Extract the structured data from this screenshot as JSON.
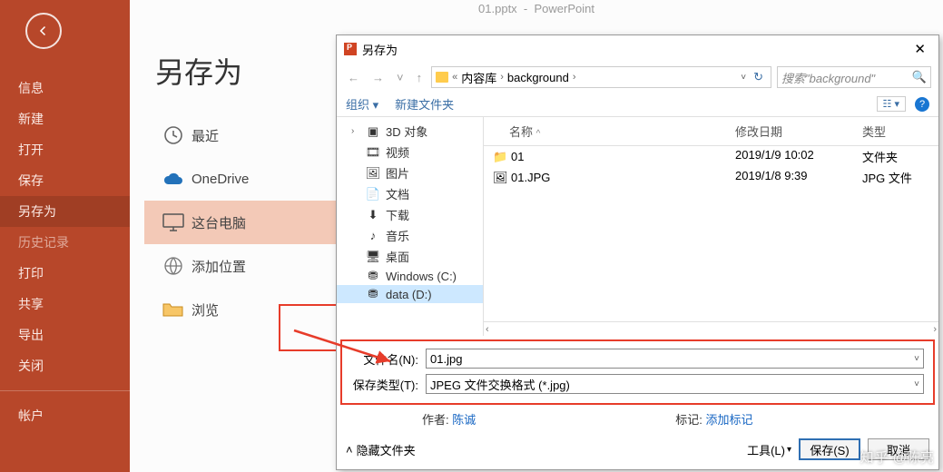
{
  "titlebar": {
    "doc": "01.pptx",
    "app": "PowerPoint"
  },
  "page_title": "另存为",
  "sidebar": {
    "items": [
      {
        "label": "信息"
      },
      {
        "label": "新建"
      },
      {
        "label": "打开"
      },
      {
        "label": "保存"
      },
      {
        "label": "另存为"
      },
      {
        "label": "历史记录"
      },
      {
        "label": "打印"
      },
      {
        "label": "共享"
      },
      {
        "label": "导出"
      },
      {
        "label": "关闭"
      },
      {
        "label": "帐户"
      }
    ]
  },
  "locations": {
    "recent": "最近",
    "onedrive": "OneDrive",
    "thispc": "这台电脑",
    "addplace": "添加位置",
    "browse": "浏览"
  },
  "dialog": {
    "title": "另存为",
    "breadcrumb": {
      "lib": "内容库",
      "folder": "background"
    },
    "search_placeholder": "搜索\"background\"",
    "toolbar": {
      "organize": "组织",
      "newfolder": "新建文件夹"
    },
    "tree": [
      {
        "icon": "3d",
        "label": "3D 对象",
        "exp": "›"
      },
      {
        "icon": "video",
        "label": "视频"
      },
      {
        "icon": "photo",
        "label": "图片"
      },
      {
        "icon": "doc",
        "label": "文档"
      },
      {
        "icon": "download",
        "label": "下载"
      },
      {
        "icon": "music",
        "label": "音乐"
      },
      {
        "icon": "desktop",
        "label": "桌面"
      },
      {
        "icon": "drive",
        "label": "Windows (C:)"
      },
      {
        "icon": "drive",
        "label": "data (D:)"
      }
    ],
    "columns": {
      "name": "名称",
      "date": "修改日期",
      "type": "类型"
    },
    "files": [
      {
        "icon": "folder",
        "name": "01",
        "date": "2019/1/9 10:02",
        "type": "文件夹"
      },
      {
        "icon": "image",
        "name": "01.JPG",
        "date": "2019/1/8 9:39",
        "type": "JPG 文件"
      }
    ],
    "fields": {
      "filename_label": "文件名(N):",
      "filename_value": "01.jpg",
      "savetype_label": "保存类型(T):",
      "savetype_value": "JPEG 文件交换格式 (*.jpg)"
    },
    "meta": {
      "author_label": "作者:",
      "author_value": "陈诚",
      "tag_label": "标记:",
      "tag_value": "添加标记"
    },
    "footer": {
      "hide": "隐藏文件夹",
      "tools": "工具(L)",
      "save": "保存(S)",
      "cancel": "取消"
    }
  },
  "watermark": {
    "site": "知乎",
    "user": "@陈亮"
  }
}
